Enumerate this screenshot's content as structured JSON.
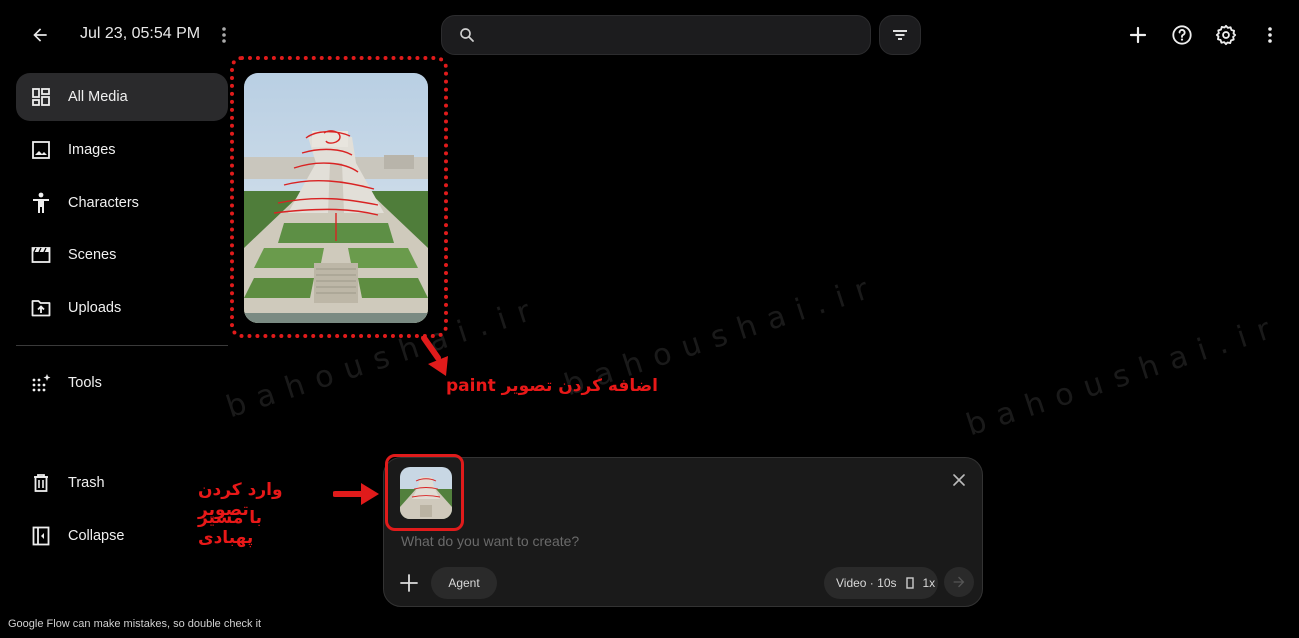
{
  "header": {
    "title": "Jul 23, 05:54 PM",
    "search_placeholder": "",
    "icons": [
      "arrow-back-icon",
      "more-vert-icon",
      "search-icon",
      "filter-icon",
      "plus-icon",
      "help-icon",
      "settings-icon",
      "more-vert-icon"
    ]
  },
  "sidebar": {
    "items": [
      {
        "label": "All Media",
        "icon": "grid-icon",
        "active": true
      },
      {
        "label": "Images",
        "icon": "image-icon"
      },
      {
        "label": "Characters",
        "icon": "person-icon"
      },
      {
        "label": "Scenes",
        "icon": "clapperboard-icon"
      },
      {
        "label": "Uploads",
        "icon": "upload-folder-icon"
      },
      {
        "label": "Tools",
        "icon": "sparkle-grid-icon"
      },
      {
        "label": "Trash",
        "icon": "trash-icon"
      },
      {
        "label": "Collapse",
        "icon": "collapse-panel-icon"
      }
    ]
  },
  "annotations": {
    "card_caption_fa": "اضافه کردن تصویر",
    "card_caption_en": "paint",
    "thumb_caption_line1": "وارد کردن تصویر",
    "thumb_caption_line2": "با مسیر پهبادی"
  },
  "composer": {
    "placeholder": "What do you want to create?",
    "agent_label": "Agent",
    "mode_label": "Video · 10s",
    "count_label": "1x"
  },
  "footer": {
    "disclaimer": "Google Flow can make mistakes, so double check it"
  },
  "watermark": "bahoushai.ir",
  "colors": {
    "background": "#000000",
    "annotation_red": "#e01b1b",
    "surface": "#1c1c1e"
  }
}
